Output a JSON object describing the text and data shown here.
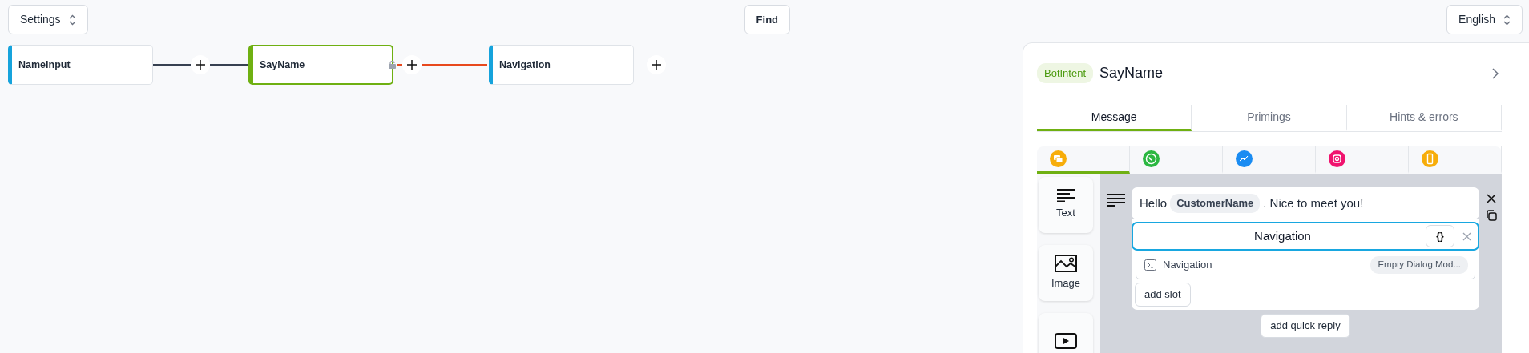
{
  "toolbar": {
    "settings": "Settings",
    "find": "Find",
    "language": "English"
  },
  "flow": {
    "nodes": [
      {
        "label": "NameInput",
        "selected": false,
        "locked": false
      },
      {
        "label": "SayName",
        "selected": true,
        "locked": true
      },
      {
        "label": "Navigation",
        "selected": false,
        "locked": false
      }
    ],
    "links": [
      {
        "color": "#374151"
      },
      {
        "color": "#e8491d"
      }
    ]
  },
  "panel": {
    "badge": "BotIntent",
    "title": "SayName",
    "tabs": [
      {
        "label": "Message",
        "selected": true
      },
      {
        "label": "Primings",
        "selected": false
      },
      {
        "label": "Hints & errors",
        "selected": false
      }
    ],
    "channels": [
      {
        "kind": "chat",
        "selected": true
      },
      {
        "kind": "whatsapp",
        "selected": false
      },
      {
        "kind": "messenger",
        "selected": false
      },
      {
        "kind": "instagram",
        "selected": false
      },
      {
        "kind": "phone",
        "selected": false
      }
    ],
    "message_types": [
      {
        "kind": "text",
        "label": "Text"
      },
      {
        "kind": "image",
        "label": "Image"
      },
      {
        "kind": "video"
      }
    ],
    "message": [
      {
        "kind": "text",
        "text": "Hello"
      },
      {
        "kind": "variable",
        "text": "CustomerName"
      },
      {
        "kind": "text",
        "text": ". Nice to meet you!"
      }
    ],
    "quick_reply": {
      "value": "Navigation",
      "braces": "{}"
    },
    "suggestions": [
      {
        "label": "Navigation",
        "tag": "Empty Dialog Mod..."
      }
    ],
    "add_slot": "add slot",
    "add_quick_reply": "add quick reply"
  }
}
